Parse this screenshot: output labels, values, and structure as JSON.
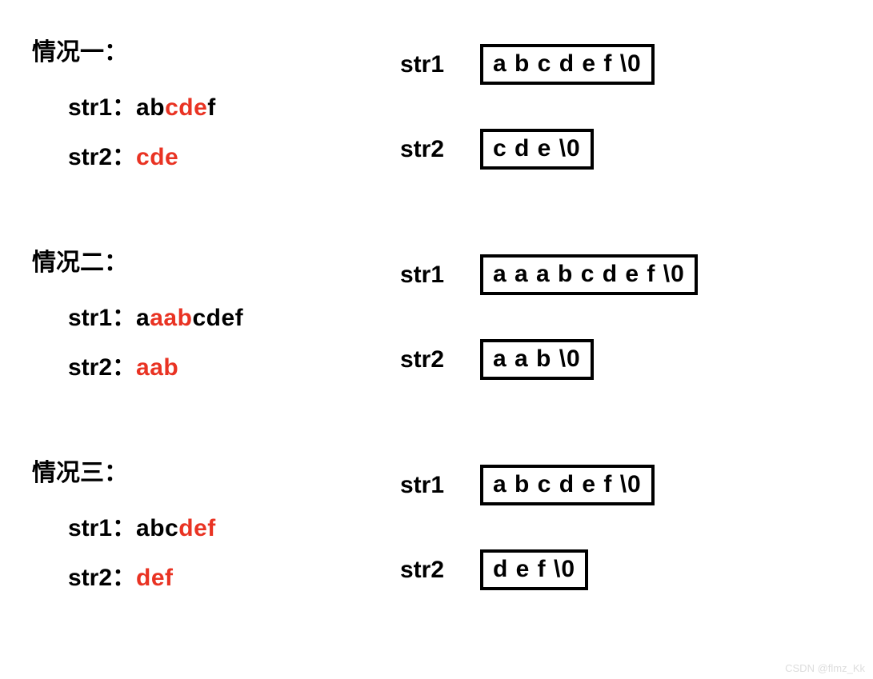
{
  "cases": [
    {
      "title": "情况一：",
      "lines": [
        {
          "label": "str1：",
          "parts": [
            [
              "ab",
              "black"
            ],
            [
              "cde",
              "red"
            ],
            [
              "f",
              "black"
            ]
          ]
        },
        {
          "label": "str2：",
          "parts": [
            [
              "cde",
              "red"
            ]
          ]
        }
      ],
      "mem": [
        {
          "label": "str1",
          "content": "a b c d e f  \\0"
        },
        {
          "label": "str2",
          "content": "c d e  \\0"
        }
      ]
    },
    {
      "title": "情况二：",
      "lines": [
        {
          "label": "str1：",
          "parts": [
            [
              "a",
              "black"
            ],
            [
              "aab",
              "red"
            ],
            [
              "cdef",
              "black"
            ]
          ]
        },
        {
          "label": "str2：",
          "parts": [
            [
              "aab",
              "red"
            ]
          ]
        }
      ],
      "mem": [
        {
          "label": "str1",
          "content": "a a a b c d e f  \\0"
        },
        {
          "label": "str2",
          "content": "a a b  \\0"
        }
      ]
    },
    {
      "title": "情况三：",
      "lines": [
        {
          "label": "str1：",
          "parts": [
            [
              "abc",
              "black"
            ],
            [
              "def",
              "red"
            ]
          ]
        },
        {
          "label": "str2：",
          "parts": [
            [
              "def",
              "red"
            ]
          ]
        }
      ],
      "mem": [
        {
          "label": "str1",
          "content": "a b c d e f  \\0"
        },
        {
          "label": "str2",
          "content": "d e f  \\0"
        }
      ]
    }
  ],
  "watermark": "CSDN @flmz_Kk"
}
